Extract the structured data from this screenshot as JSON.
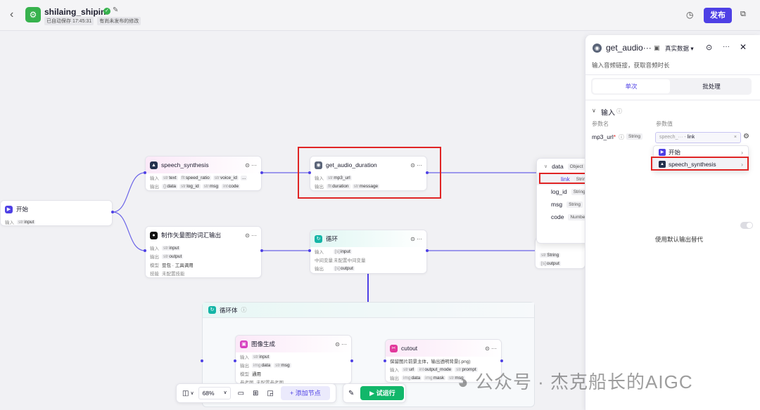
{
  "header": {
    "app_name": "shilaing_shipin",
    "autosave": "已自动保存 17:45:31",
    "unpublished": "有尚未发布的修改",
    "publish_label": "发布"
  },
  "nodes": {
    "start": {
      "title": "开始",
      "in_label": "输入",
      "p1": "input"
    },
    "speech": {
      "title": "speech_synthesis",
      "in_label": "输入",
      "out_label": "输出",
      "i1": "text",
      "i2": "speed_ratio",
      "i3": "voice_id",
      "i4": "...",
      "o1": "data",
      "o2": "log_id",
      "o3": "msg",
      "o4": "code"
    },
    "duration": {
      "title": "get_audio_duration",
      "in_label": "输入",
      "out_label": "输出",
      "i1": "mp3_url",
      "o1": "duration",
      "o2": "message"
    },
    "vector": {
      "title": "制作矢量图的词汇输出",
      "in_label": "输入",
      "out_label": "输出",
      "mode_label": "模型",
      "skill_label": "技能",
      "i1": "input",
      "o1": "output",
      "mode": "豆包 · 工具调用",
      "skill": "未配置技能"
    },
    "loop": {
      "title": "循环",
      "in_label": "输入",
      "mid_label": "中间变量",
      "out_label": "输出",
      "i1": "input",
      "mid": "未配置中间变量",
      "o1": "output"
    },
    "loopbody": {
      "title": "循环体"
    },
    "imggen": {
      "title": "图像生成",
      "in_label": "输入",
      "out_label": "输出",
      "model_label": "模型",
      "ref_label": "参考图",
      "i1": "input",
      "o1": "data",
      "o2": "msg",
      "model": "通用",
      "ref": "未配置参考图"
    },
    "cutout": {
      "title": "cutout",
      "desc": "保留图片前景主体，输出透明背景(.png)",
      "in_label": "输入",
      "out_label": "输出",
      "i1": "url",
      "i2": "output_mode",
      "i3": "prompt",
      "o1": "data",
      "o2": "mask",
      "o3": "msg"
    },
    "right_partial": {
      "o1": "String",
      "o2": "output"
    }
  },
  "popup": {
    "items": [
      {
        "name": "data",
        "type": "Object"
      },
      {
        "name": "link",
        "type": "String"
      },
      {
        "name": "log_id",
        "type": "String"
      },
      {
        "name": "msg",
        "type": "String"
      },
      {
        "name": "code",
        "type": "Number"
      }
    ]
  },
  "panel": {
    "title": "get_audio···",
    "data_mode": "真实数据",
    "desc": "输入音频链接，获取音频时长",
    "tab_single": "单次",
    "tab_batch": "批处理",
    "input_section": "输入",
    "col_name": "参数名",
    "col_value": "参数值",
    "param_name": "mp3_url",
    "param_type": "String",
    "value_prefix": "speech_···",
    "value_sep": "-",
    "value_field": "link",
    "fallback_text": "使用默认输出替代"
  },
  "source_menu": {
    "item1": "开始",
    "item2": "speech_synthesis"
  },
  "toolbar": {
    "zoom": "68%",
    "add_node": "添加节点",
    "run": "试运行"
  },
  "watermark": "公众号 · 杰克船长的AIGC",
  "colors": {
    "accent": "#4e40e5",
    "run": "#12b76a",
    "highlight": "#e02424"
  }
}
